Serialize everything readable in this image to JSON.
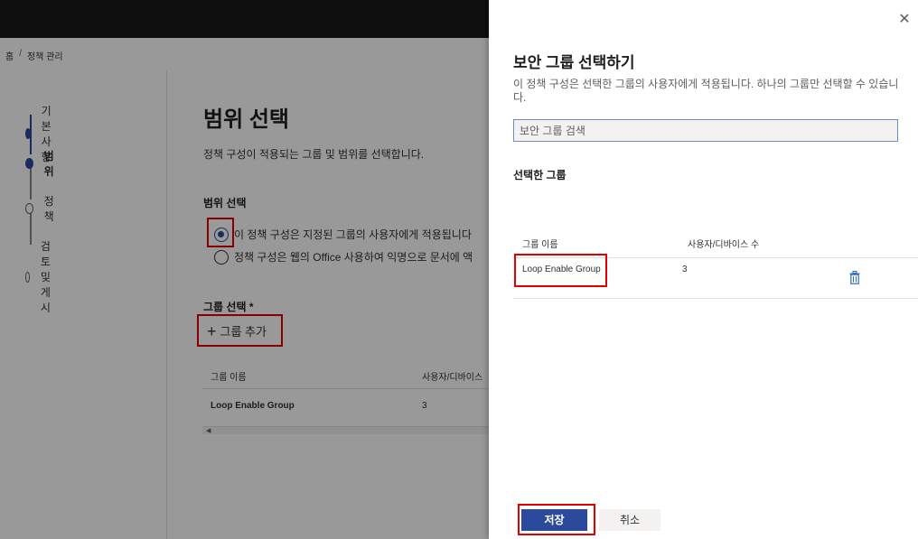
{
  "breadcrumb": {
    "home": "홈",
    "separator": "/",
    "current": "정책 관리"
  },
  "steps": [
    {
      "label": "기본 사항",
      "state": "completed"
    },
    {
      "label": "범위",
      "state": "current"
    },
    {
      "label": "정책",
      "state": "pending"
    },
    {
      "label": "검토 및 게시",
      "state": "pending"
    }
  ],
  "main": {
    "title": "범위 선택",
    "description": "정책 구성이 적용되는 그룹 및 범위를 선택합니다.",
    "scope_heading": "범위 선택",
    "radio_options": [
      {
        "label": "이 정책 구성은 지정된 그룹의 사용자에게 적용됩니다",
        "checked": true
      },
      {
        "label": "정책 구성은 웹의 Office 사용하여 익명으로 문서에 액",
        "checked": false
      }
    ],
    "group_heading": "그룹 선택 *",
    "add_group_label": "그룹 추가",
    "table": {
      "headers": [
        "그룹 이름",
        "사용자/디바이스"
      ],
      "rows": [
        {
          "name": "Loop Enable Group",
          "count": "3"
        }
      ]
    }
  },
  "panel": {
    "title": "보안 그룹 선택하기",
    "description": "이 정책 구성은 선택한 그룹의 사용자에게 적용됩니다. 하나의 그룹만 선택할 수 있습니다.",
    "search_placeholder": "보안 그룹 검색",
    "selected_heading": "선택한 그룹",
    "table": {
      "headers": [
        "그룹 이름",
        "사용자/디바이스 수"
      ],
      "rows": [
        {
          "name": "Loop Enable Group",
          "count": "3"
        }
      ]
    },
    "save_label": "저장",
    "cancel_label": "취소"
  },
  "colors": {
    "accent": "#2b4a9c",
    "highlight": "#e00000",
    "topbar": "#1b1a19"
  },
  "icons": [
    "close-icon",
    "plus-icon",
    "trash-icon"
  ]
}
